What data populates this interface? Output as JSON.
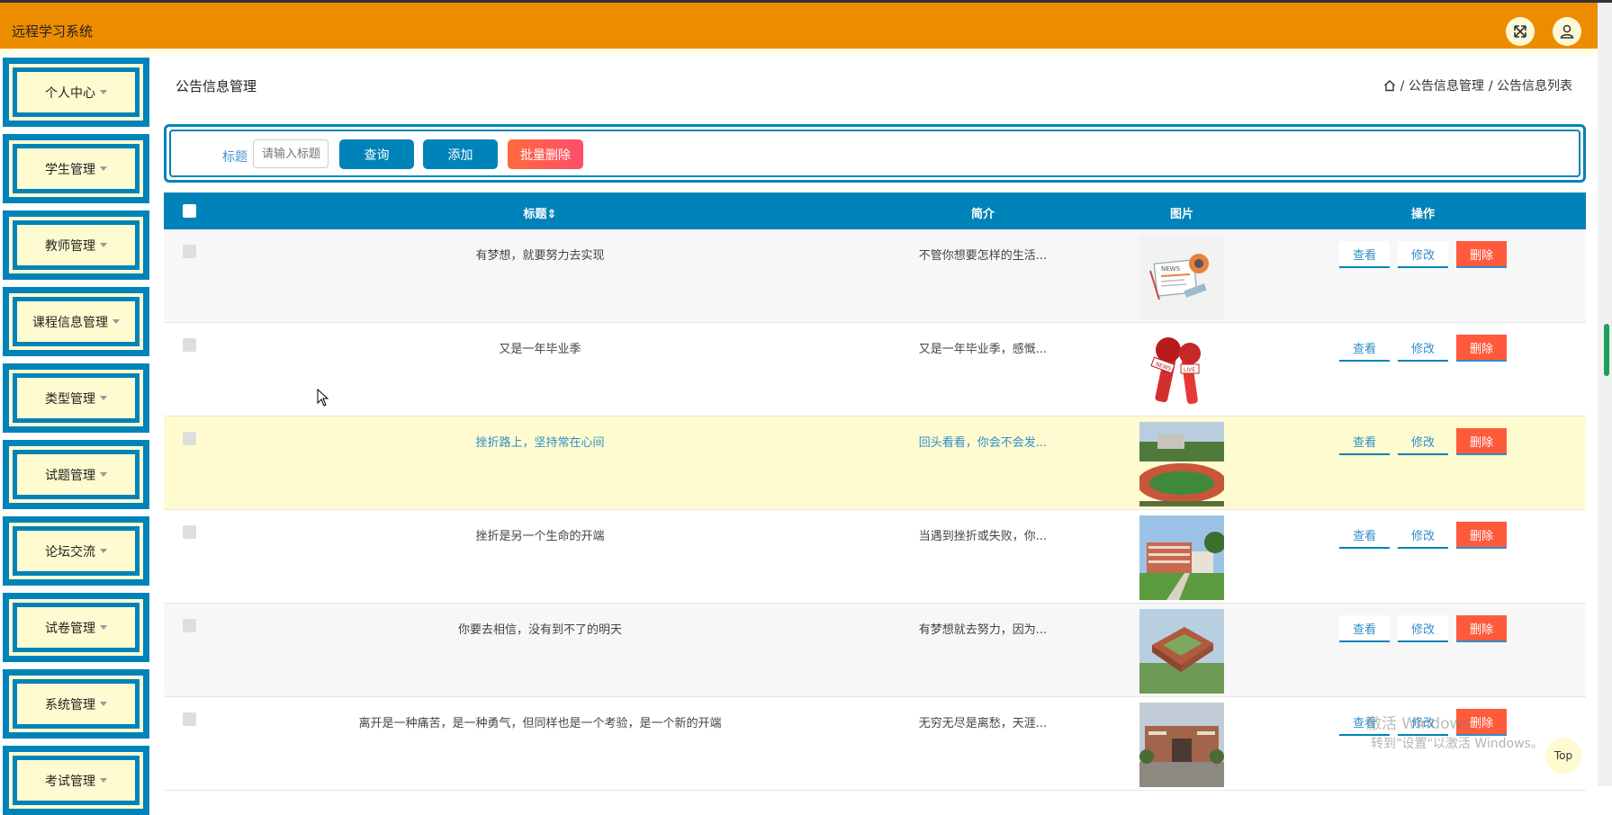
{
  "app": {
    "title": "远程学习系统"
  },
  "sidebar": {
    "items": [
      {
        "label": "个人中心"
      },
      {
        "label": "学生管理"
      },
      {
        "label": "教师管理"
      },
      {
        "label": "课程信息管理"
      },
      {
        "label": "类型管理"
      },
      {
        "label": "试题管理"
      },
      {
        "label": "论坛交流"
      },
      {
        "label": "试卷管理"
      },
      {
        "label": "系统管理"
      },
      {
        "label": "考试管理"
      }
    ]
  },
  "page": {
    "title": "公告信息管理",
    "breadcrumb": [
      "/ 公告信息管理",
      "/ 公告信息列表"
    ]
  },
  "search": {
    "label": "标题",
    "placeholder": "请输入标题",
    "query_label": "查询",
    "add_label": "添加",
    "batch_delete_label": "批量删除"
  },
  "table": {
    "columns": [
      "标题",
      "简介",
      "图片",
      "操作"
    ],
    "sort_icon": "⇕",
    "rows": [
      {
        "title": "有梦想，就要努力去实现",
        "desc": "不管你想要怎样的生活...",
        "image": "news-illustration"
      },
      {
        "title": "又是一年毕业季",
        "desc": "又是一年毕业季，感慨...",
        "image": "news-microphones"
      },
      {
        "title": "挫折路上，坚持常在心间",
        "desc": "回头看看，你会不会发...",
        "image": "campus-track-photo"
      },
      {
        "title": "挫折是另一个生命的开端",
        "desc": "当遇到挫折或失败，你...",
        "image": "campus-building-photo"
      },
      {
        "title": "你要去相信，没有到不了的明天",
        "desc": "有梦想就去努力，因为...",
        "image": "campus-aerial-photo"
      },
      {
        "title": "离开是一种痛苦，是一种勇气，但同样也是一个考验，是一个新的开端",
        "desc": "无穷无尽是离愁，天涯...",
        "image": "school-gate-photo"
      }
    ],
    "actions": {
      "view": "查看",
      "edit": "修改",
      "delete": "删除"
    }
  },
  "overlay": {
    "watermark_line1": "激活 Windows",
    "watermark_line2": "转到\"设置\"以激活 Windows。",
    "top_button": "Top"
  },
  "colors": {
    "header": "#ee8c00",
    "primary": "#0083b9",
    "menu_bg": "#fffbd0",
    "danger": "#ff5a3c",
    "highlight_row": "#fffbd0"
  }
}
